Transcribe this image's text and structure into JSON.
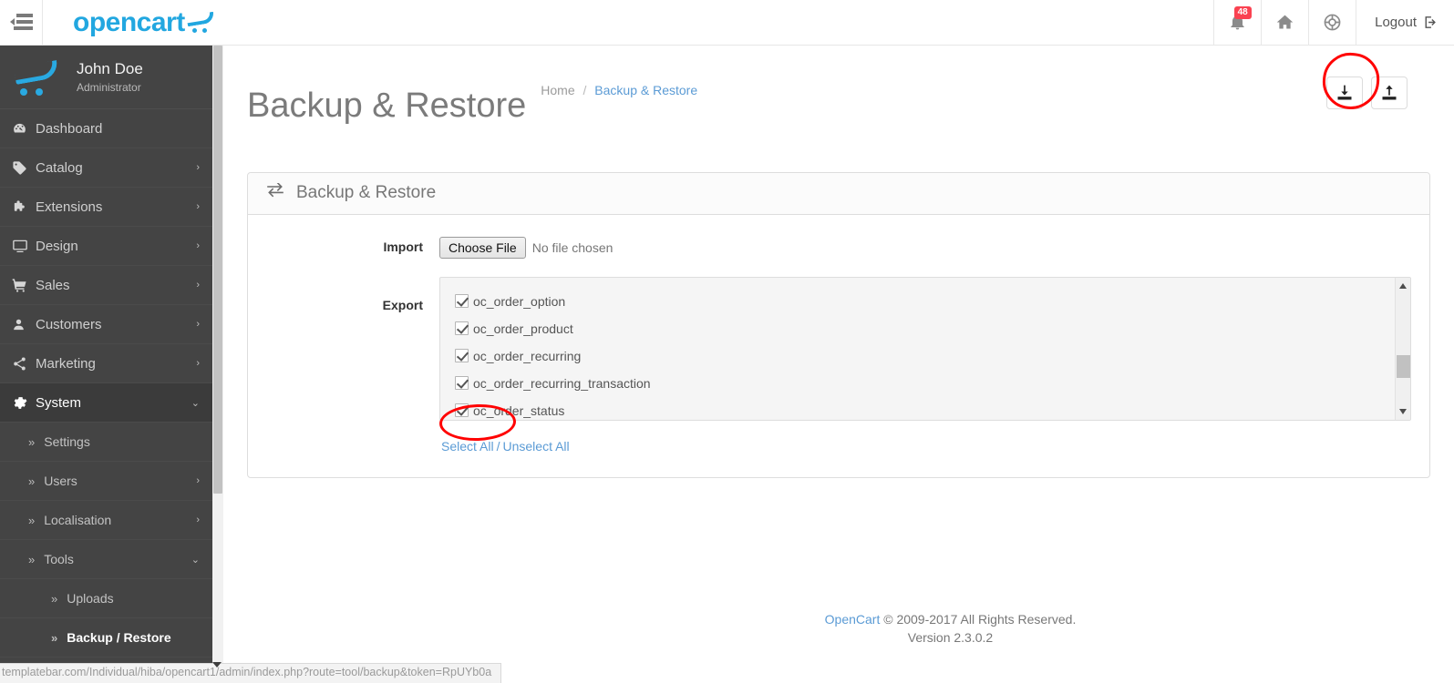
{
  "header": {
    "menu_toggle_icon": "sidebar-toggle-icon",
    "brand": "opencart",
    "notifications": {
      "icon": "bell-icon",
      "count": "48"
    },
    "home": {
      "icon": "home-icon"
    },
    "help": {
      "icon": "lifebuoy-icon"
    },
    "logout": {
      "label": "Logout",
      "icon": "logout-icon"
    }
  },
  "sidebar": {
    "user": {
      "name": "John Doe",
      "role": "Administrator",
      "avatar_icon": "opencart-cart-icon"
    },
    "items": [
      {
        "label": "Dashboard",
        "icon": "dashboard-icon",
        "caret": "",
        "active": false
      },
      {
        "label": "Catalog",
        "icon": "tag-icon",
        "caret": "›",
        "active": false
      },
      {
        "label": "Extensions",
        "icon": "puzzle-icon",
        "caret": "›",
        "active": false
      },
      {
        "label": "Design",
        "icon": "monitor-icon",
        "caret": "›",
        "active": false
      },
      {
        "label": "Sales",
        "icon": "shopping-cart-icon",
        "caret": "›",
        "active": false
      },
      {
        "label": "Customers",
        "icon": "user-icon",
        "caret": "›",
        "active": false
      },
      {
        "label": "Marketing",
        "icon": "share-icon",
        "caret": "›",
        "active": false
      },
      {
        "label": "System",
        "icon": "gear-icon",
        "caret": "⌄",
        "active": true
      }
    ],
    "system_children": [
      {
        "label": "Settings",
        "caret": ""
      },
      {
        "label": "Users",
        "caret": "›"
      },
      {
        "label": "Localisation",
        "caret": "›"
      },
      {
        "label": "Tools",
        "caret": "⌄"
      }
    ],
    "tools_children": [
      {
        "label": "Uploads",
        "active": false
      },
      {
        "label": "Backup / Restore",
        "active": true
      }
    ]
  },
  "page": {
    "title": "Backup & Restore",
    "breadcrumb": {
      "home": "Home",
      "separator": "/",
      "current": "Backup & Restore"
    },
    "actions": [
      {
        "name": "export-button",
        "icon": "download-icon"
      },
      {
        "name": "import-button",
        "icon": "upload-icon"
      }
    ]
  },
  "panel": {
    "icon": "exchange-arrows-icon",
    "title": "Backup & Restore",
    "import": {
      "label": "Import",
      "button_label": "Choose File",
      "file_status": "No file chosen"
    },
    "export": {
      "label": "Export",
      "tables": [
        {
          "name": "oc_order_option",
          "checked": true
        },
        {
          "name": "oc_order_product",
          "checked": true
        },
        {
          "name": "oc_order_recurring",
          "checked": true
        },
        {
          "name": "oc_order_recurring_transaction",
          "checked": true
        },
        {
          "name": "oc_order_status",
          "checked": true
        }
      ],
      "select_all": "Select All",
      "separator": "/",
      "unselect_all": "Unselect All"
    }
  },
  "footer": {
    "brand_link": "OpenCart",
    "copyright": "© 2009-2017 All Rights Reserved.",
    "version": "Version 2.3.0.2"
  },
  "statusbar": {
    "url": "templatebar.com/Individual/hiba/opencart1/admin/index.php?route=tool/backup&token=RpUYb0a"
  },
  "annotations": {
    "accent_color": "#ff0000",
    "circled": [
      "export-button",
      "select-all-link"
    ]
  }
}
